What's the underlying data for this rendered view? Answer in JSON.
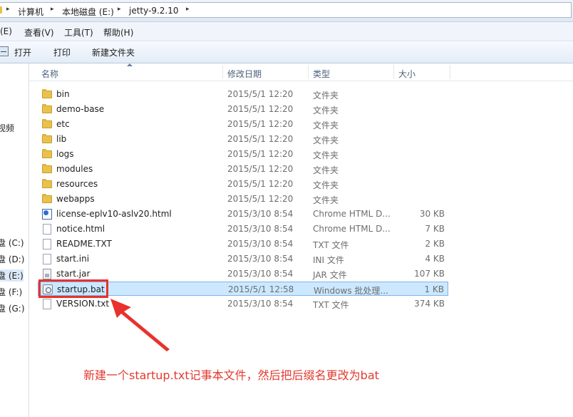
{
  "address_bar": {
    "crumbs": [
      "计算机",
      "本地磁盘 (E:)",
      "jetty-9.2.10"
    ],
    "separator": "▸"
  },
  "menu_bar": {
    "items": [
      "编辑(E)",
      "查看(V)",
      "工具(T)",
      "帮助(H)"
    ],
    "first_visible_fragment": "(E)"
  },
  "command_bar": {
    "items": [
      "打开",
      "打印",
      "新建文件夹"
    ]
  },
  "nav_pane": {
    "items": [
      "视频",
      "盘 (C:)",
      "盘 (D:)",
      "盘 (E:)",
      "盘 (F:)",
      "盘 (G:)"
    ],
    "selected_index": 3
  },
  "columns": {
    "name": "名称",
    "date": "修改日期",
    "type": "类型",
    "size": "大小"
  },
  "files": [
    {
      "name": "bin",
      "date": "2015/5/1 12:20",
      "type": "文件夹",
      "size": "",
      "icon": "folder-icon"
    },
    {
      "name": "demo-base",
      "date": "2015/5/1 12:20",
      "type": "文件夹",
      "size": "",
      "icon": "folder-icon"
    },
    {
      "name": "etc",
      "date": "2015/5/1 12:20",
      "type": "文件夹",
      "size": "",
      "icon": "folder-icon"
    },
    {
      "name": "lib",
      "date": "2015/5/1 12:20",
      "type": "文件夹",
      "size": "",
      "icon": "folder-icon"
    },
    {
      "name": "logs",
      "date": "2015/5/1 12:20",
      "type": "文件夹",
      "size": "",
      "icon": "folder-icon"
    },
    {
      "name": "modules",
      "date": "2015/5/1 12:20",
      "type": "文件夹",
      "size": "",
      "icon": "folder-icon"
    },
    {
      "name": "resources",
      "date": "2015/5/1 12:20",
      "type": "文件夹",
      "size": "",
      "icon": "folder-icon"
    },
    {
      "name": "webapps",
      "date": "2015/5/1 12:20",
      "type": "文件夹",
      "size": "",
      "icon": "folder-icon"
    },
    {
      "name": "license-eplv10-aslv20.html",
      "date": "2015/3/10 8:54",
      "type": "Chrome HTML D...",
      "size": "30 KB",
      "icon": "html-file-icon"
    },
    {
      "name": "notice.html",
      "date": "2015/3/10 8:54",
      "type": "Chrome HTML D...",
      "size": "7 KB",
      "icon": "html-file-icon"
    },
    {
      "name": "README.TXT",
      "date": "2015/3/10 8:54",
      "type": "TXT 文件",
      "size": "2 KB",
      "icon": "text-file-icon"
    },
    {
      "name": "start.ini",
      "date": "2015/3/10 8:54",
      "type": "INI 文件",
      "size": "4 KB",
      "icon": "text-file-icon"
    },
    {
      "name": "start.jar",
      "date": "2015/3/10 8:54",
      "type": "JAR 文件",
      "size": "107 KB",
      "icon": "jar-file-icon"
    },
    {
      "name": "startup.bat",
      "date": "2015/5/1 12:58",
      "type": "Windows 批处理...",
      "size": "1 KB",
      "icon": "batch-file-icon"
    },
    {
      "name": "VERSION.txt",
      "date": "2015/3/10 8:54",
      "type": "TXT 文件",
      "size": "374 KB",
      "icon": "text-file-icon"
    }
  ],
  "selected_file_index": 13,
  "annotation": {
    "text": "新建一个startup.txt记事本文件，然后把后缀名更改为bat",
    "color": "#e23a2f"
  }
}
